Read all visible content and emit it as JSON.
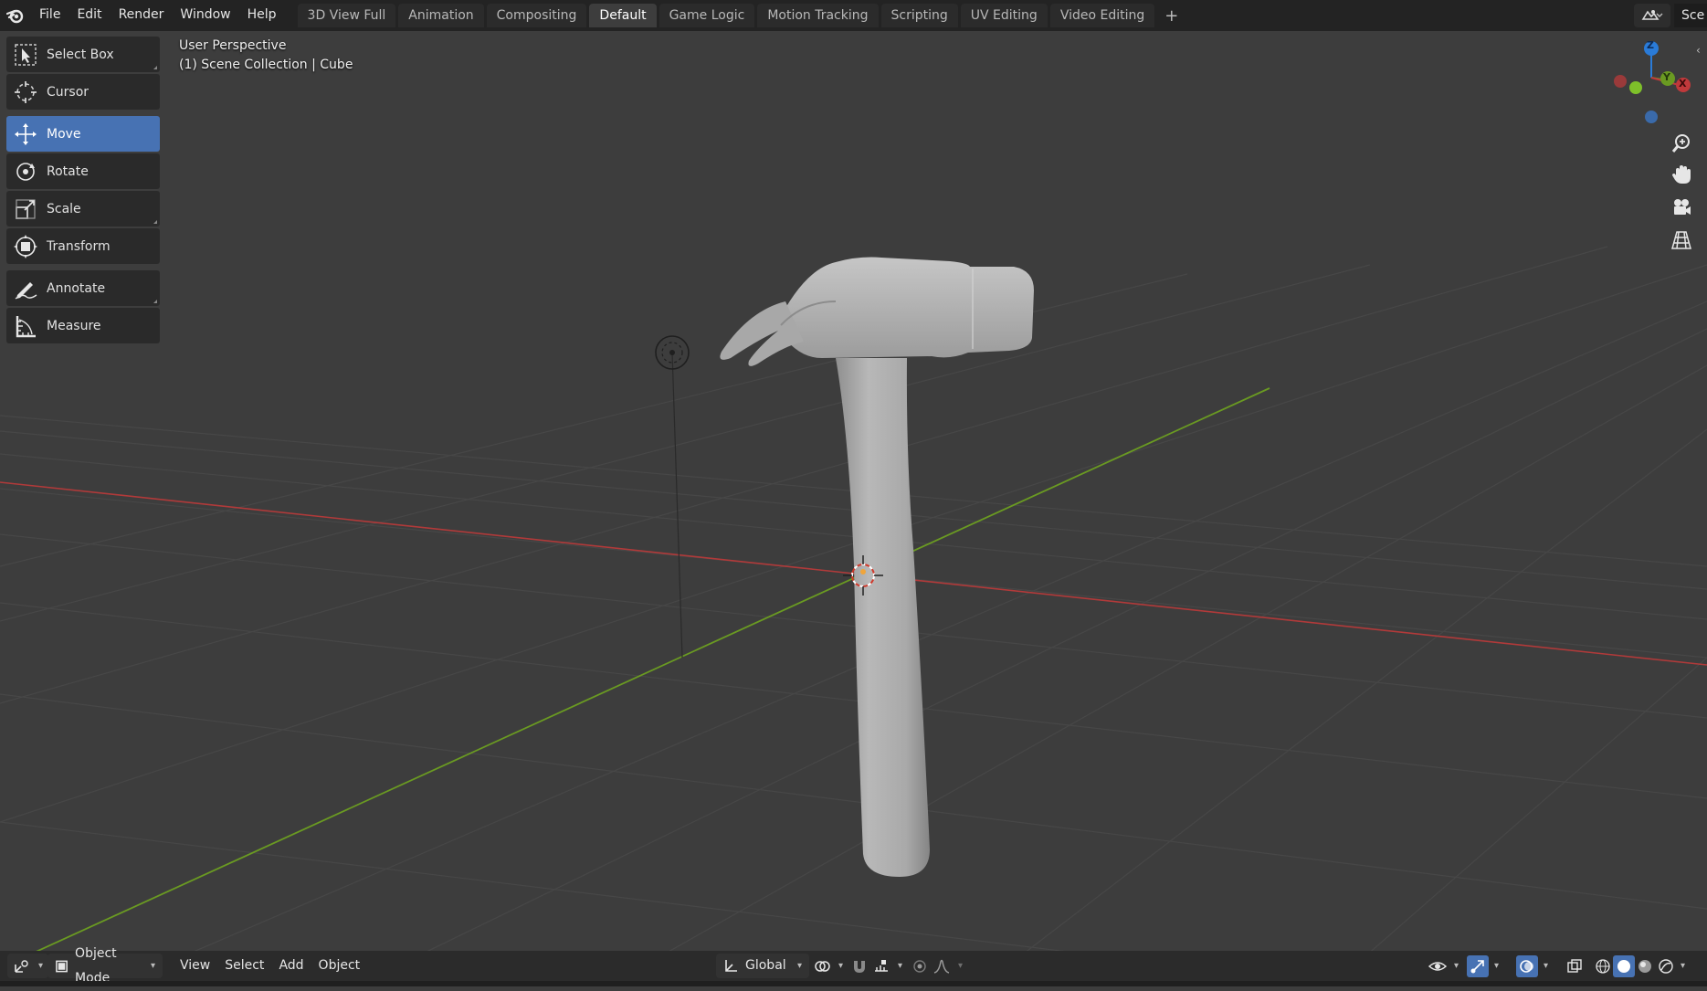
{
  "menu": [
    "File",
    "Edit",
    "Render",
    "Window",
    "Help"
  ],
  "workspaces": [
    {
      "label": "3D View Full"
    },
    {
      "label": "Animation"
    },
    {
      "label": "Compositing"
    },
    {
      "label": "Default",
      "active": true
    },
    {
      "label": "Game Logic"
    },
    {
      "label": "Motion Tracking"
    },
    {
      "label": "Scripting"
    },
    {
      "label": "UV Editing"
    },
    {
      "label": "Video Editing"
    }
  ],
  "add_workspace": "+",
  "scene_name": "Sce",
  "viewport": {
    "perspective": "User Perspective",
    "collection": "(1) Scene Collection | Cube"
  },
  "tools": [
    {
      "label": "Select Box",
      "icon": "select-box-icon"
    },
    {
      "label": "Cursor",
      "icon": "cursor-icon"
    },
    {
      "label": "Move",
      "icon": "move-icon",
      "active": true
    },
    {
      "label": "Rotate",
      "icon": "rotate-icon"
    },
    {
      "label": "Scale",
      "icon": "scale-icon"
    },
    {
      "label": "Transform",
      "icon": "transform-icon"
    },
    {
      "label": "Annotate",
      "icon": "annotate-icon"
    },
    {
      "label": "Measure",
      "icon": "measure-icon"
    }
  ],
  "gizmo_axes": {
    "z": "Z",
    "y": "Y",
    "x": "X"
  },
  "colors": {
    "accent": "#4772b3",
    "x_axis": "#b13a3a",
    "y_axis": "#6a9a22",
    "z_axis": "#2a7bd8"
  },
  "header": {
    "mode": "Object Mode",
    "menus": [
      "View",
      "Select",
      "Add",
      "Object"
    ],
    "orientation": "Global"
  }
}
